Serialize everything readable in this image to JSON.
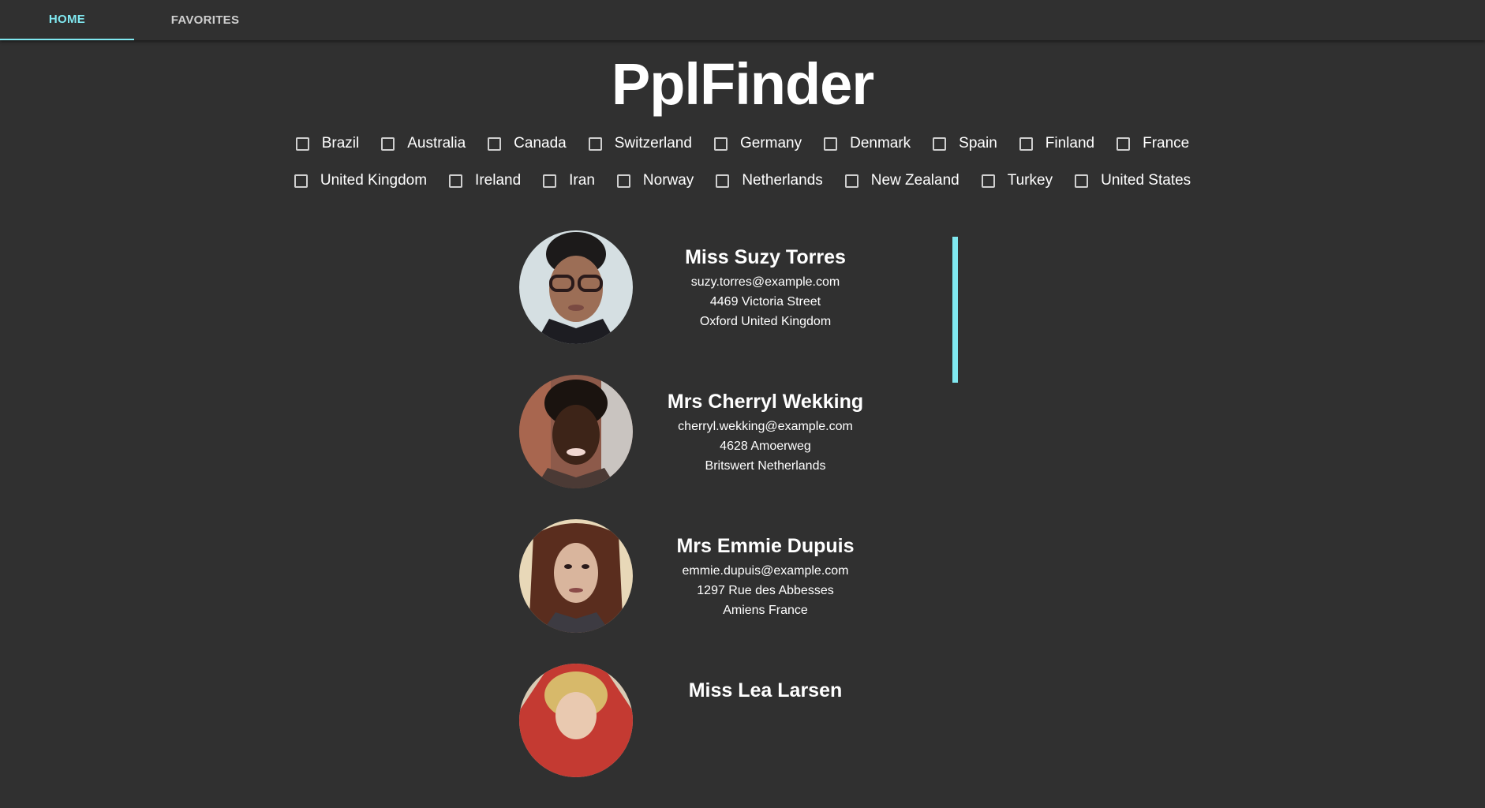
{
  "tabs": {
    "home": "HOME",
    "favorites": "FAVORITES"
  },
  "title": "PplFinder",
  "countries_row1": [
    "Brazil",
    "Australia",
    "Canada",
    "Switzerland",
    "Germany",
    "Denmark",
    "Spain",
    "Finland",
    "France"
  ],
  "countries_row2": [
    "United Kingdom",
    "Ireland",
    "Iran",
    "Norway",
    "Netherlands",
    "New Zealand",
    "Turkey",
    "United States"
  ],
  "users": [
    {
      "name": "Miss Suzy Torres",
      "email": "suzy.torres@example.com",
      "street": "4469 Victoria Street",
      "city": "Oxford United Kingdom"
    },
    {
      "name": "Mrs Cherryl Wekking",
      "email": "cherryl.wekking@example.com",
      "street": "4628 Amoerweg",
      "city": "Britswert Netherlands"
    },
    {
      "name": "Mrs Emmie Dupuis",
      "email": "emmie.dupuis@example.com",
      "street": "1297 Rue des Abbesses",
      "city": "Amiens France"
    },
    {
      "name": "Miss Lea Larsen",
      "email": "",
      "street": "",
      "city": ""
    }
  ],
  "colors": {
    "background": "#303030",
    "accent": "#80e8f0",
    "text": "#ffffff"
  }
}
